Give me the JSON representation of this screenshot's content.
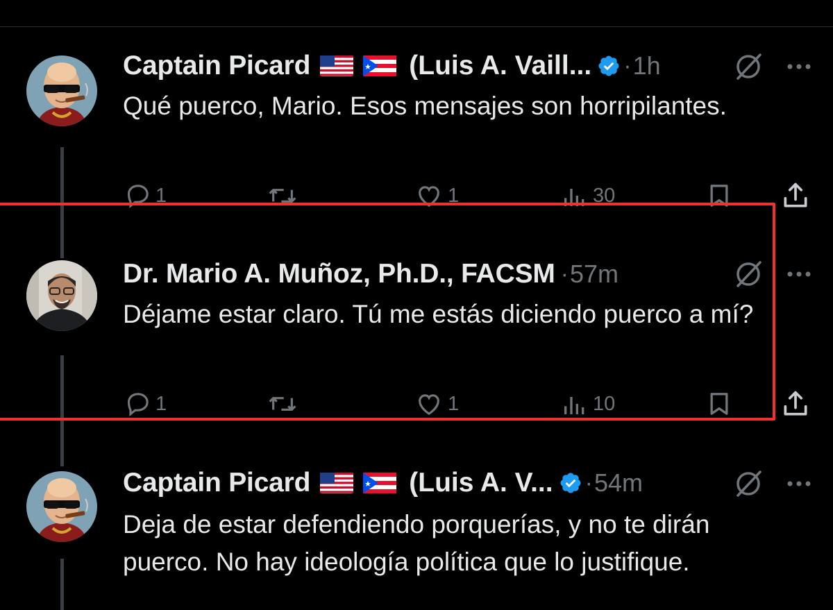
{
  "tweets": [
    {
      "name": "Captain Picard",
      "name_suffix": "(Luis A. Vaill...",
      "verified": true,
      "time": "1h",
      "text": "Qué puerco, Mario. Esos mensajes son horripilantes.",
      "counts": {
        "replies": "1",
        "retweets": "",
        "likes": "1",
        "views": "30"
      }
    },
    {
      "name": "Dr. Mario A. Muñoz, Ph.D., FACSM",
      "verified": false,
      "time": "57m",
      "text": "Déjame estar claro. Tú me estás diciendo puerco a mí?",
      "counts": {
        "replies": "1",
        "retweets": "",
        "likes": "1",
        "views": "10"
      }
    },
    {
      "name": "Captain Picard",
      "name_suffix": "(Luis A. V...",
      "verified": true,
      "time": "54m",
      "text": "Deja de estar defendiendo porquerías, y no te dirán puerco. No hay ideología política que lo justifique."
    }
  ],
  "separator": "·",
  "colors": {
    "background": "#000000",
    "text": "#e7e9ea",
    "muted": "#71767b",
    "verified": "#1d9bf0",
    "highlight_box": "#f2312f"
  },
  "icons": [
    "reply-icon",
    "retweet-icon",
    "like-icon",
    "views-icon",
    "bookmark-icon",
    "share-icon",
    "grok-icon",
    "more-icon",
    "verified-badge-icon",
    "us-flag-icon",
    "puerto-rico-flag-icon"
  ]
}
